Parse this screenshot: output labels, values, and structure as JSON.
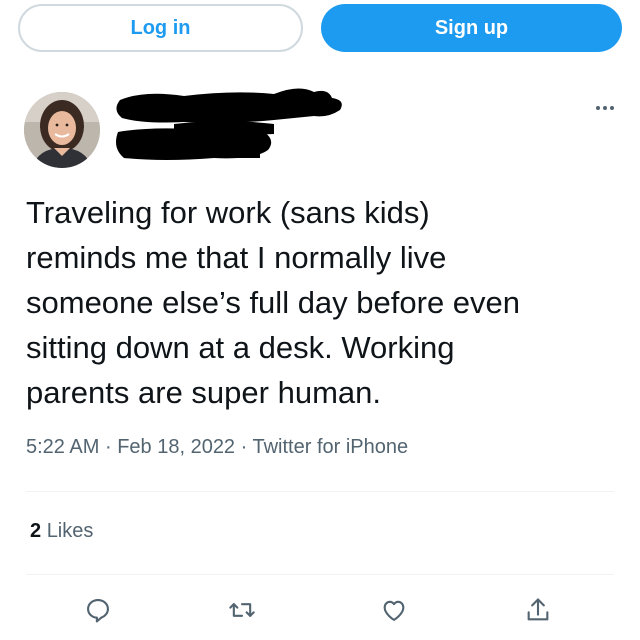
{
  "auth": {
    "login_label": "Log in",
    "signup_label": "Sign up"
  },
  "tweet": {
    "text": "Traveling for work (sans kids)\nreminds me that I normally live\nsomeone else’s full day before even\nsitting down at a desk. Working\nparents are super human.",
    "time": "5:22 AM",
    "separator": "·",
    "date": "Feb 18, 2022",
    "source": "Twitter for iPhone",
    "likes_count": "2",
    "likes_label": "Likes"
  },
  "icons": {
    "more": "more-icon",
    "reply": "reply-icon",
    "retweet": "retweet-icon",
    "like": "heart-icon",
    "share": "share-icon"
  },
  "colors": {
    "accent": "#1d9bf0",
    "text": "#0f1419",
    "muted": "#536471",
    "border": "#cfd9de"
  }
}
